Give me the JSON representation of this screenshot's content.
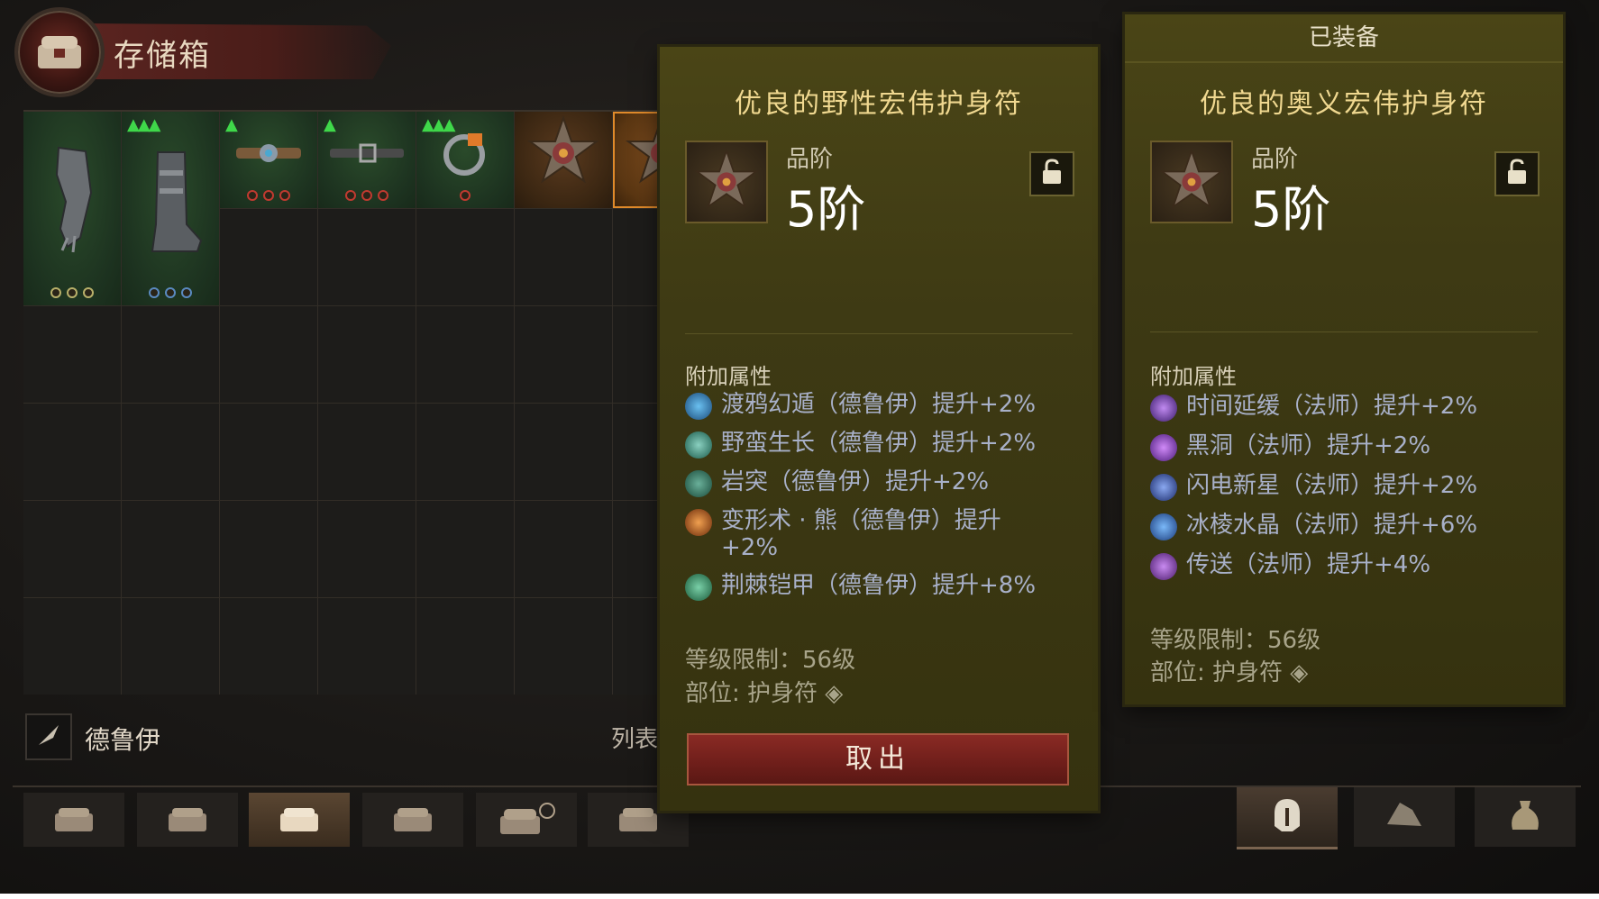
{
  "header": {
    "title": "存储箱"
  },
  "class_filter": {
    "label": "德鲁伊",
    "list_label": "列表"
  },
  "left_panel": {
    "name": "优良的野性宏伟护身符",
    "tier_label": "品阶",
    "tier_value": "5阶",
    "section_label": "附加属性",
    "affixes": [
      {
        "text": "渡鸦幻遁（德鲁伊）提升+2%",
        "icon": "raven-icon",
        "color": "#3a8ad0"
      },
      {
        "text": "野蛮生长（德鲁伊）提升+2%",
        "icon": "vine-icon",
        "color": "#3a9a8a"
      },
      {
        "text": "岩突（德鲁伊）提升+2%",
        "icon": "boulder-icon",
        "color": "#3a8a6a"
      },
      {
        "text": "变形术 · 熊（德鲁伊）提升",
        "text2": "+2%",
        "icon": "bear-icon",
        "color": "#c86a2a"
      },
      {
        "text": "荆棘铠甲（德鲁伊）提升+8%",
        "icon": "thorns-icon",
        "color": "#3aa07a"
      }
    ],
    "level_req": "等级限制：56级",
    "slot": "部位: 护身符",
    "take_button": "取出"
  },
  "right_panel": {
    "equipped_label": "已装备",
    "name": "优良的奥义宏伟护身符",
    "tier_label": "品阶",
    "tier_value": "5阶",
    "section_label": "附加属性",
    "affixes": [
      {
        "text": "时间延缓（法师）提升+2%",
        "icon": "slow-time-icon",
        "color": "#7a3ad0"
      },
      {
        "text": "黑洞（法师）提升+2%",
        "icon": "black-hole-icon",
        "color": "#8a3ad8"
      },
      {
        "text": "闪电新星（法师）提升+2%",
        "icon": "lightning-nova-icon",
        "color": "#4a6ad0"
      },
      {
        "text": "冰棱水晶（法师）提升+6%",
        "icon": "ice-crystal-icon",
        "color": "#3a7ad8"
      },
      {
        "text": "传送（法师）提升+4%",
        "icon": "teleport-icon",
        "color": "#9a4ad0"
      }
    ],
    "level_req": "等级限制：56级",
    "slot": "部位: 护身符"
  },
  "colors": {
    "panel_bg": "#3e3a14",
    "title_gold": "#f0d890",
    "affix_text": "#a8b0c8",
    "upgrade_green": "#3fd84a",
    "button_red": "#6e1e1a"
  }
}
